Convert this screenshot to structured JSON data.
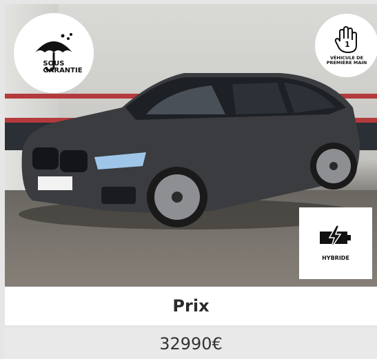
{
  "badges": {
    "garantie_line1": "SOUS",
    "garantie_line2": "GARANTIE",
    "premiere_line1": "VÉHICULE DE",
    "premiere_line2": "PREMIÈRE MAIN",
    "premiere_number": "1",
    "hybride": "HYBRIDE"
  },
  "listing": {
    "price_label": "Prix",
    "price_value": "32990€"
  },
  "colors": {
    "car_body": "#3a3c40",
    "wall_stripe": "#b43a3c",
    "price_bg": "#e9e9e9"
  },
  "icons": {
    "garantie": "umbrella-icon",
    "premiere": "hand-one-icon",
    "hybride": "battery-bolt-icon"
  }
}
